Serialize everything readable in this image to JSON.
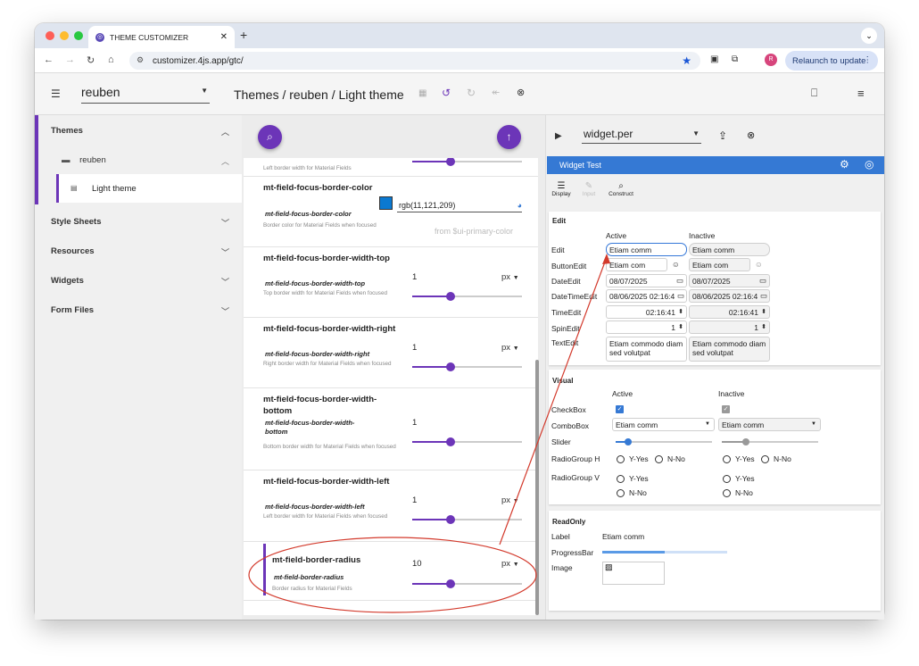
{
  "browser": {
    "tab_title": "THEME CUSTOMIZER",
    "url": "customizer.4js.app/gtc/",
    "profile_initial": "R",
    "relaunch_label": "Relaunch to update"
  },
  "appbar": {
    "user": "reuben",
    "breadcrumb": "Themes / reuben / Light theme"
  },
  "sidebar": {
    "themes": "Themes",
    "folder": "reuben",
    "light_theme": "Light theme",
    "style_sheets": "Style Sheets",
    "resources": "Resources",
    "widgets": "Widgets",
    "form_files": "Form Files"
  },
  "props": {
    "top_desc": "Left border width for Material Fields",
    "p1": {
      "name": "mt-field-focus-border-color",
      "ident": "mt-field-focus-border-color",
      "desc": "Border color for Material Fields when focused",
      "value": "rgb(11,121,209)",
      "hint": "from $ui-primary-color"
    },
    "p2": {
      "name": "mt-field-focus-border-width-top",
      "ident": "mt-field-focus-border-width-top",
      "desc": "Top border width for Material Fields when focused",
      "value": "1",
      "unit": "px",
      "slider": 0.35
    },
    "p3": {
      "name": "mt-field-focus-border-width-right",
      "ident": "mt-field-focus-border-width-right",
      "desc": "Right border width for Material Fields when focused",
      "value": "1",
      "unit": "px",
      "slider": 0.35
    },
    "p4": {
      "name": "mt-field-focus-border-width-bottom",
      "ident": "mt-field-focus-border-width-bottom",
      "desc": "Bottom border width for Material Fields when focused",
      "value": "1",
      "unit": "px",
      "slider": 0.35
    },
    "p5": {
      "name": "mt-field-focus-border-width-left",
      "ident": "mt-field-focus-border-width-left",
      "desc": "Left border width for Material Fields when focused",
      "value": "1",
      "unit": "px",
      "slider": 0.35
    },
    "p6": {
      "name": "mt-field-border-radius",
      "ident": "mt-field-border-radius",
      "desc": "Border radius for Material Fields",
      "value": "10",
      "unit": "px",
      "slider": 0.35
    },
    "top_slider": 0.35
  },
  "preview": {
    "file": "widget.per",
    "window_title": "Widget Test",
    "toolbar": {
      "display": "Display",
      "input": "Input",
      "construct": "Construct"
    },
    "edit_panel": {
      "title": "Edit",
      "active": "Active",
      "inactive": "Inactive",
      "rows": [
        {
          "label": "Edit",
          "active": "Etiam comm",
          "inactive": "Etiam comm"
        },
        {
          "label": "ButtonEdit",
          "active": "Etiam com",
          "inactive": "Etiam com"
        },
        {
          "label": "DateEdit",
          "active": "08/07/2025",
          "inactive": "08/07/2025"
        },
        {
          "label": "DateTimeEdit",
          "active": "08/06/2025 02:16:4",
          "inactive": "08/06/2025 02:16:4"
        },
        {
          "label": "TimeEdit",
          "active": "02:16:41",
          "inactive": "02:16:41"
        },
        {
          "label": "SpinEdit",
          "active": "1",
          "inactive": "1"
        },
        {
          "label": "TextEdit",
          "active": "Etiam commodo diam sed volutpat",
          "inactive": "Etiam commodo diam sed volutpat"
        }
      ]
    },
    "visual_panel": {
      "title": "Visual",
      "active": "Active",
      "inactive": "Inactive",
      "checkbox": "CheckBox",
      "combobox": "ComboBox",
      "combo_value": "Etiam comm",
      "slider": "Slider",
      "radio_h": "RadioGroup H",
      "radio_v": "RadioGroup V",
      "yes": "Y-Yes",
      "no": "N-No",
      "slider_active": 0.14,
      "slider_inactive": 0.26
    },
    "readonly_panel": {
      "title": "ReadOnly",
      "label": "Label",
      "label_value": "Etiam comm",
      "progress": "ProgressBar",
      "image": "Image",
      "progress_value": 0.5
    }
  },
  "colors": {
    "accent": "#6c35b8",
    "preview_blue": "#3579d4",
    "annotation": "#d33a2c",
    "swatch": "#0b79d1"
  }
}
